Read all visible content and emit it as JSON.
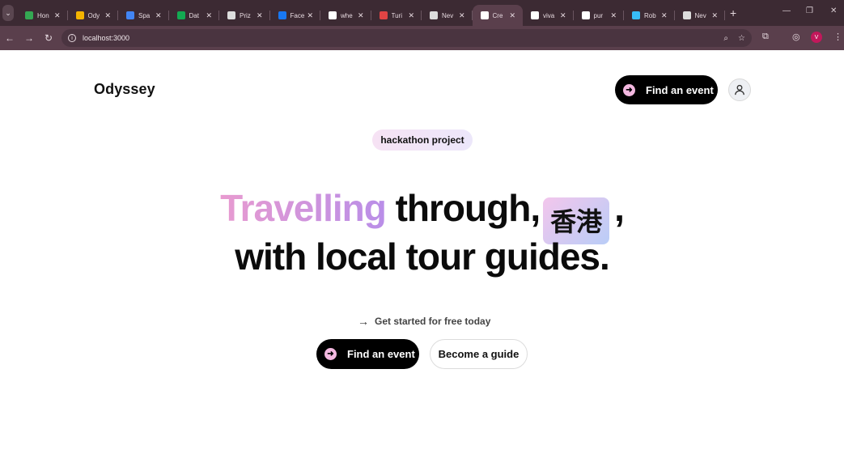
{
  "browser": {
    "tabs": [
      {
        "label": "Hon",
        "icon": "drive-icon",
        "color": "#34a853"
      },
      {
        "label": "Ody",
        "icon": "slides-icon",
        "color": "#f4b400"
      },
      {
        "label": "Spa",
        "icon": "doc-icon",
        "color": "#4285f4"
      },
      {
        "label": "Dat",
        "icon": "mongodb-leaf-icon",
        "color": "#13aa52"
      },
      {
        "label": "Priz",
        "icon": "chat-icon",
        "color": "#dddddd"
      },
      {
        "label": "Face",
        "icon": "facebook-icon",
        "color": "#1877f2"
      },
      {
        "label": "whe",
        "icon": "google-icon",
        "color": "#ffffff"
      },
      {
        "label": "Turi",
        "icon": "circle-icon",
        "color": "#e04444"
      },
      {
        "label": "Nev",
        "icon": "chrome-icon",
        "color": "#dddddd"
      },
      {
        "label": "Cre",
        "icon": "triangle-icon",
        "color": "#ffffff",
        "active": true
      },
      {
        "label": "viva",
        "icon": "github-icon",
        "color": "#ffffff"
      },
      {
        "label": "pur",
        "icon": "google-icon",
        "color": "#ffffff"
      },
      {
        "label": "Rob",
        "icon": "tailwind-icon",
        "color": "#38bdf8"
      },
      {
        "label": "Nev",
        "icon": "chrome-icon",
        "color": "#dddddd"
      }
    ],
    "url": "localhost:3000",
    "profile_initial": "V"
  },
  "header": {
    "logo": "Odyssey",
    "find_event": "Find an event"
  },
  "hero": {
    "badge": "hackathon project",
    "line1_highlight": "Travelling",
    "line1_rest": "through,",
    "place": "香港",
    "line1_comma": ",",
    "line2": "with local tour guides.",
    "cta_text": "Get started for free today",
    "find_event": "Find an event",
    "become_guide": "Become a guide"
  },
  "colors": {
    "accent_pink": "#e89bd0",
    "accent_purple": "#b98ee8",
    "button_dark": "#000000",
    "chrome_bg": "#3c2a33"
  }
}
